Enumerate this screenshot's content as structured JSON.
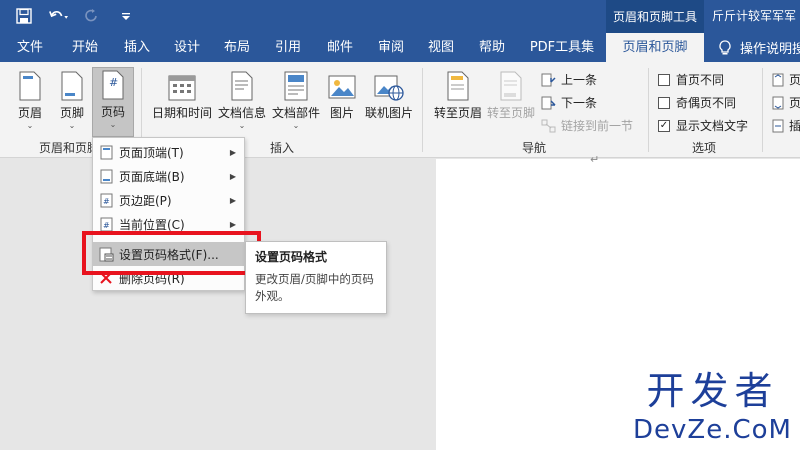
{
  "quick_access": [
    "save-icon",
    "undo-icon",
    "redo-icon",
    "customize-icon"
  ],
  "title_bar": {
    "context_tab_title": "页眉和页脚工具",
    "document_title": "斤斤计较军军军"
  },
  "tabs": [
    "文件",
    "开始",
    "插入",
    "设计",
    "布局",
    "引用",
    "邮件",
    "审阅",
    "视图",
    "帮助",
    "PDF工具集",
    "页眉和页脚"
  ],
  "active_tab": "页眉和页脚",
  "tell_me": "操作说明搜",
  "ribbon": {
    "hf_group": {
      "header": "页眉",
      "footer": "页脚",
      "page_number": "页码",
      "label": "页眉和页脚"
    },
    "insert_group": {
      "date_time": "日期和时间",
      "doc_info": "文档信息",
      "doc_parts": "文档部件",
      "picture": "图片",
      "online_picture": "联机图片",
      "label": "插入"
    },
    "nav_group": {
      "goto_header": "转至页眉",
      "goto_footer": "转至页脚",
      "previous": "上一条",
      "next": "下一条",
      "link_previous": "链接到前一节",
      "label": "导航"
    },
    "options_group": {
      "different_first": "首页不同",
      "different_odd_even": "奇偶页不同",
      "show_doc_text": "显示文档文字",
      "show_doc_text_checked": true,
      "label": "选项"
    },
    "position_group": {
      "item1": "页",
      "item2": "页",
      "item3": "插"
    }
  },
  "menu": {
    "items": [
      {
        "label": "页面顶端(T)",
        "submenu": true
      },
      {
        "label": "页面底端(B)",
        "submenu": true
      },
      {
        "label": "页边距(P)",
        "submenu": true
      },
      {
        "label": "当前位置(C)",
        "submenu": true
      },
      {
        "label": "设置页码格式(F)...",
        "submenu": false
      },
      {
        "label": "删除页码(R)",
        "submenu": false
      }
    ]
  },
  "tooltip": {
    "title": "设置页码格式",
    "description": "更改页眉/页脚中的页码外观。"
  },
  "watermark": {
    "chinese": "开发者",
    "english": "DevZe.CoM"
  },
  "colors": {
    "title_bar": "#2b579a",
    "highlight_box": "#e8131e",
    "watermark": "#1d3f99"
  }
}
